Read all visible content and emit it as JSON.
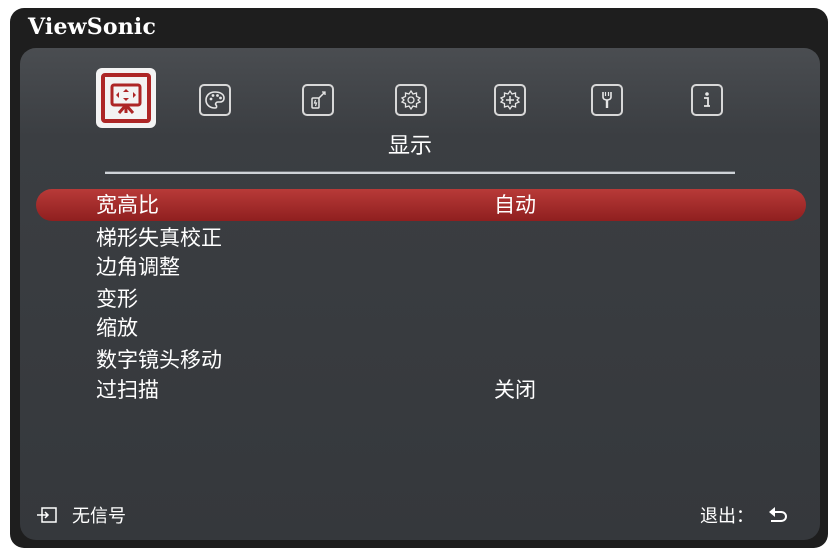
{
  "brand": "ViewSonic",
  "tabs": [
    {
      "name": "display-icon",
      "active": true
    },
    {
      "name": "palette-icon",
      "active": false
    },
    {
      "name": "power-icon",
      "active": false
    },
    {
      "name": "gear-icon",
      "active": false
    },
    {
      "name": "advanced-gear-icon",
      "active": false
    },
    {
      "name": "wrench-icon",
      "active": false
    },
    {
      "name": "info-icon",
      "active": false
    }
  ],
  "tab_title": "显示",
  "menu": {
    "items": [
      {
        "label": "宽高比",
        "value": "自动"
      },
      {
        "label": "梯形失真校正",
        "value": ""
      },
      {
        "label": "边角调整",
        "value": ""
      },
      {
        "label": "变形",
        "value": ""
      },
      {
        "label": "缩放",
        "value": ""
      },
      {
        "label": "数字镜头移动",
        "value": ""
      },
      {
        "label": "过扫描",
        "value": "关闭"
      }
    ]
  },
  "footer": {
    "source_status": "无信号",
    "exit_label": "退出：",
    "source_icon": "input-source-icon",
    "exit_icon": "return-arrow-icon"
  },
  "colors": {
    "accent": "#ad2626",
    "panel": "#3b3e42",
    "frame": "#1e1e1e"
  }
}
